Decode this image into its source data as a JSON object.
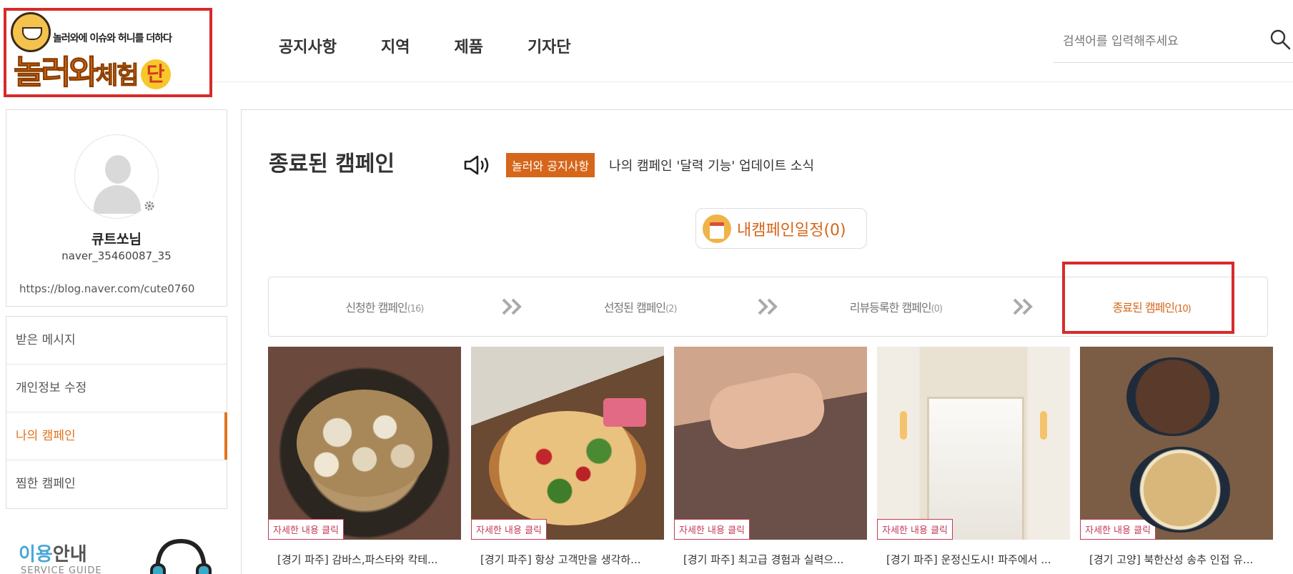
{
  "header": {
    "logo": {
      "tagline": "놀러와에 이슈와 허니를 더하다",
      "brand_main": "놀러와",
      "brand_small": "체험",
      "brand_badge": "단"
    },
    "nav": [
      {
        "label": "공지사항"
      },
      {
        "label": "지역"
      },
      {
        "label": "제품"
      },
      {
        "label": "기자단"
      }
    ],
    "search": {
      "placeholder": "검색어를 입력해주세요",
      "icon": "search-icon"
    }
  },
  "profile": {
    "name": "큐트쏘님",
    "id": "naver_35460087_35",
    "blog_url": "https://blog.naver.com/cute0760"
  },
  "side_menu": [
    {
      "label": "받은 메시지",
      "active": false
    },
    {
      "label": "개인정보 수정",
      "active": false
    },
    {
      "label": "나의 캠페인",
      "active": true
    },
    {
      "label": "찜한 캠페인",
      "active": false
    }
  ],
  "guide": {
    "title_accent": "이용",
    "title_rest": "안내",
    "subtitle": "SERVICE GUIDE"
  },
  "main": {
    "title": "종료된 캠페인",
    "notice": {
      "tag": "놀러와 공지사항",
      "text": "나의 캠페인 '달력 기능' 업데이트 소식"
    },
    "schedule_button": "내캠페인일정(0)",
    "steps": [
      {
        "label": "신청한 캠페인",
        "count": "(16)",
        "active": false
      },
      {
        "label": "선정된 캠페인",
        "count": "(2)",
        "active": false
      },
      {
        "label": "리뷰등록한 캠페인",
        "count": "(0)",
        "active": false
      },
      {
        "label": "종료된 캠페인",
        "count": "(10)",
        "active": true
      }
    ],
    "cards": [
      {
        "tag": "자세한 내용 클릭",
        "title": "[경기 파주] 감바스,파스타와 칵테..."
      },
      {
        "tag": "자세한 내용 클릭",
        "title": "[경기 파주] 항상 고객만을 생각하..."
      },
      {
        "tag": "자세한 내용 클릭",
        "title": "[경기 파주] 최고급 경험과 실력으..."
      },
      {
        "tag": "자세한 내용 클릭",
        "title": "[경기 파주] 운정신도시! 파주에서 ..."
      },
      {
        "tag": "자세한 내용 클릭",
        "title": "[경기 고양] 북한산성 송추 인접 유..."
      }
    ]
  },
  "colors": {
    "accent": "#d6661a",
    "highlight": "#d62b2b",
    "tag": "#c43a57",
    "guide": "#4aa7d6"
  }
}
